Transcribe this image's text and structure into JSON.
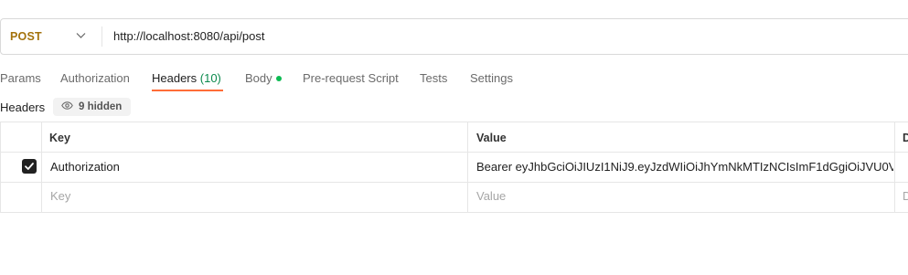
{
  "request": {
    "method": "POST",
    "url": "http://localhost:8080/api/post"
  },
  "tabs": [
    {
      "label": "Params"
    },
    {
      "label": "Authorization"
    },
    {
      "label": "Headers",
      "count": "(10)"
    },
    {
      "label": "Body"
    },
    {
      "label": "Pre-request Script"
    },
    {
      "label": "Tests"
    },
    {
      "label": "Settings"
    }
  ],
  "headers_section": {
    "title": "Headers",
    "hidden_badge": "9 hidden"
  },
  "table": {
    "columns": [
      "Key",
      "Value",
      "D"
    ],
    "rows": [
      {
        "checked": true,
        "key": "Authorization",
        "value": "Bearer eyJhbGciOiJIUzI1NiJ9.eyJzdWIiOiJhYmNkMTIzNCIsImF1dGgiOiJVU0V",
        "desc": ""
      }
    ],
    "new_row": {
      "key_placeholder": "Key",
      "value_placeholder": "Value",
      "desc_placeholder": "D"
    }
  },
  "colors": {
    "active_tab_underline": "#ff6c37",
    "method": "#a3720c",
    "count": "#0c8a4d",
    "body_dot": "#0cbb52"
  }
}
